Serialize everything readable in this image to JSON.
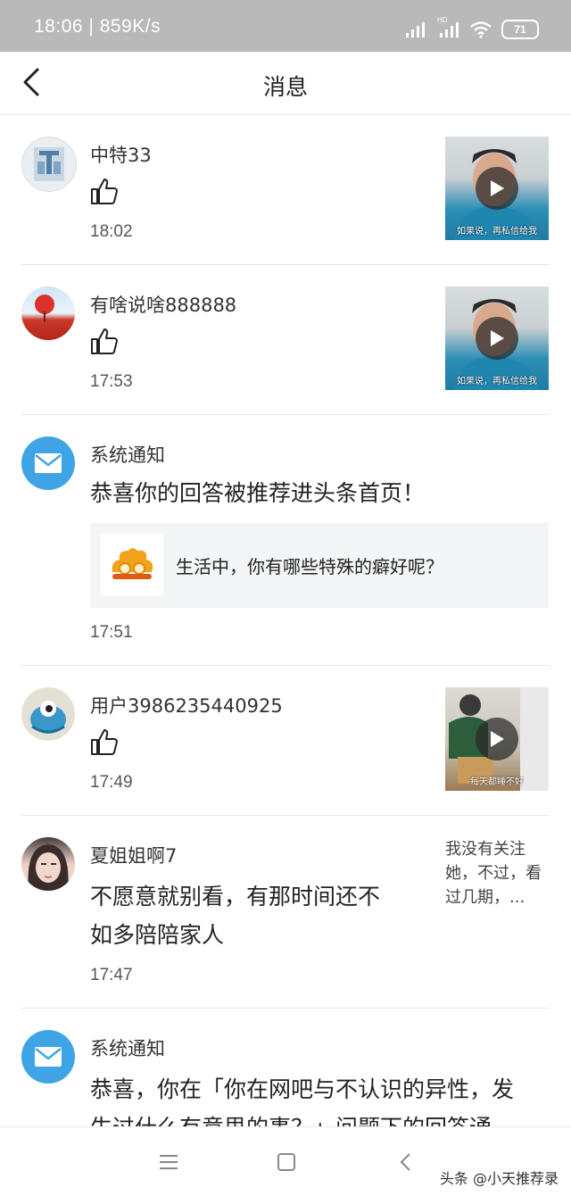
{
  "status_bar": {
    "time": "18:06",
    "speed": "859K/s",
    "signal_label": "HD",
    "battery": "71"
  },
  "header": {
    "title": "消息"
  },
  "messages": [
    {
      "name": "中特33",
      "time": "18:02",
      "type": "like",
      "thumbnail_caption": "如果说，再私信给我"
    },
    {
      "name": "有啥说啥888888",
      "time": "17:53",
      "type": "like",
      "thumbnail_caption": "如果说，再私信给我"
    },
    {
      "name": "系统通知",
      "time": "17:51",
      "type": "system",
      "text": "恭喜你的回答被推荐进头条首页！",
      "quote": "生活中，你有哪些特殊的癖好呢？"
    },
    {
      "name": "用户3986235440925",
      "time": "17:49",
      "type": "like",
      "thumbnail_caption": "每天都睡不好"
    },
    {
      "name": "夏姐姐啊7",
      "time": "17:47",
      "type": "comment",
      "text_line1": "不愿意就别看，有那时间还不",
      "text_line2": "如多陪陪家人",
      "reply_line1": "我没有关注",
      "reply_line2": "她，不过，看",
      "reply_line3": "过几期，..."
    },
    {
      "name": "系统通知",
      "type": "system",
      "text_line1": "恭喜，你在「你在网吧与不认识的异性，发",
      "text_line2": "生过什么有意思的事？」问题下的回答通"
    }
  ],
  "watermark": "头条 @小天推荐录",
  "colors": {
    "status_bar": "#b9b9b9",
    "system_icon": "#3fa4e6",
    "divider": "#e8e8e8"
  }
}
